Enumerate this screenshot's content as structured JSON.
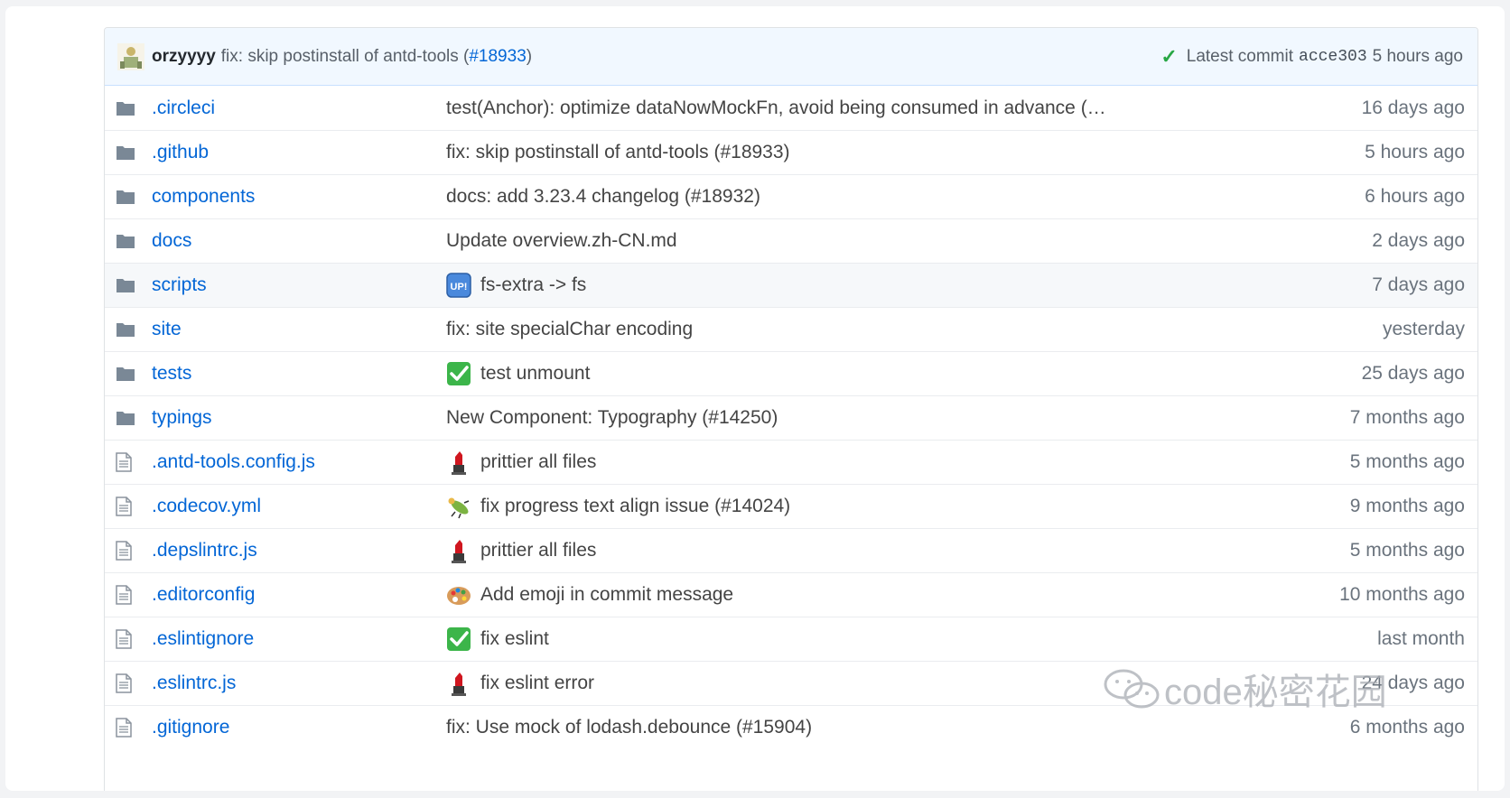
{
  "latest_commit": {
    "author": "orzyyyy",
    "message": "fix: skip postinstall of antd-tools (",
    "pr": "#18933",
    "message_end": ")",
    "label": "Latest commit",
    "sha": "acce303",
    "age": "5 hours ago"
  },
  "rows": [
    {
      "type": "folder",
      "name": ".circleci",
      "message": "test(Anchor): optimize dataNowMockFn, avoid being consumed in advance (…",
      "emoji": "",
      "age": "16 days ago"
    },
    {
      "type": "folder",
      "name": ".github",
      "message": "fix: skip postinstall of antd-tools (#18933)",
      "emoji": "",
      "age": "5 hours ago"
    },
    {
      "type": "folder",
      "name": "components",
      "message": "docs: add 3.23.4 changelog (#18932)",
      "emoji": "",
      "age": "6 hours ago"
    },
    {
      "type": "folder",
      "name": "docs",
      "message": "Update overview.zh-CN.md",
      "emoji": "",
      "age": "2 days ago"
    },
    {
      "type": "folder",
      "name": "scripts",
      "message": "fs-extra -> fs",
      "emoji": "up",
      "age": "7 days ago"
    },
    {
      "type": "folder",
      "name": "site",
      "message": "fix: site specialChar encoding",
      "emoji": "",
      "age": "yesterday"
    },
    {
      "type": "folder",
      "name": "tests",
      "message": "test unmount",
      "emoji": "check",
      "age": "25 days ago"
    },
    {
      "type": "folder",
      "name": "typings",
      "message": "New Component: Typography (#14250)",
      "emoji": "",
      "age": "7 months ago"
    },
    {
      "type": "file",
      "name": ".antd-tools.config.js",
      "message": "prittier all files",
      "emoji": "lipstick",
      "age": "5 months ago"
    },
    {
      "type": "file",
      "name": ".codecov.yml",
      "message": "fix progress text align issue (#14024)",
      "emoji": "bug",
      "age": "9 months ago"
    },
    {
      "type": "file",
      "name": ".depslintrc.js",
      "message": "prittier all files",
      "emoji": "lipstick",
      "age": "5 months ago"
    },
    {
      "type": "file",
      "name": ".editorconfig",
      "message": "Add emoji in commit message",
      "emoji": "palette",
      "age": "10 months ago"
    },
    {
      "type": "file",
      "name": ".eslintignore",
      "message": "fix eslint",
      "emoji": "check",
      "age": "last month"
    },
    {
      "type": "file",
      "name": ".eslintrc.js",
      "message": "fix eslint error",
      "emoji": "lipstick",
      "age": "24 days ago"
    },
    {
      "type": "file",
      "name": ".gitignore",
      "message": "fix: Use mock of lodash.debounce (#15904)",
      "emoji": "",
      "age": "6 months ago"
    }
  ],
  "hover_row_index": 4,
  "watermark": "code秘密花园",
  "colors": {
    "link": "#0366d6",
    "commit_bar": "#f1f8ff",
    "check": "#28a745",
    "folder": "#79b8ff"
  }
}
